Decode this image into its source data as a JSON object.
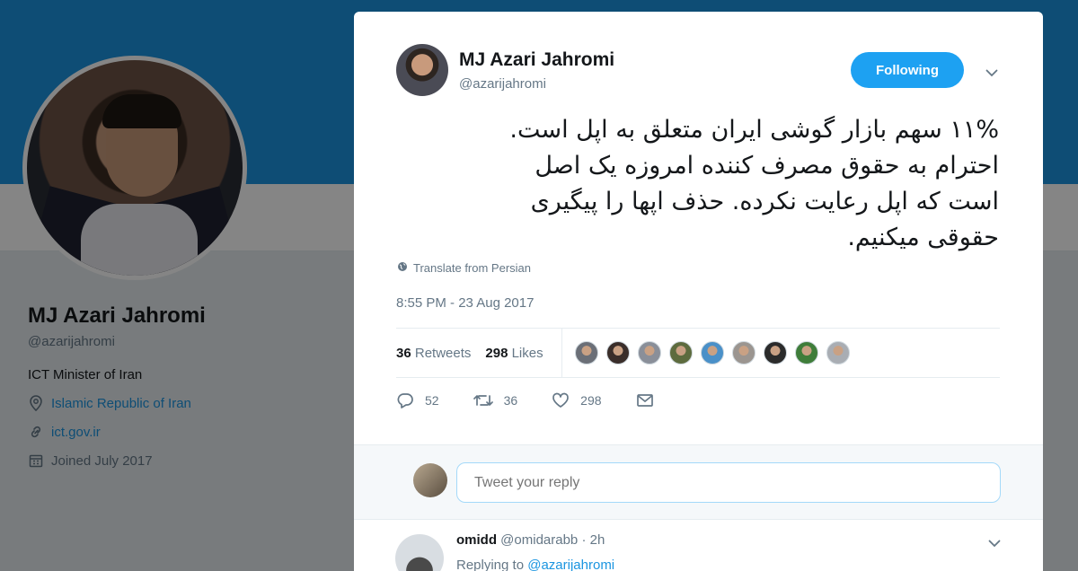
{
  "profile": {
    "name": "MJ Azari Jahromi",
    "handle": "@azarijahromi",
    "bio": "ICT Minister of Iran",
    "location": "Islamic Republic of Iran",
    "website": "ict.gov.ir",
    "joined": "Joined July 2017",
    "location_icon": "location-pin-icon",
    "link_icon": "link-icon",
    "calendar_icon": "calendar-icon"
  },
  "tweet": {
    "author_name": "MJ Azari Jahromi",
    "author_handle": "@azarijahromi",
    "follow_label": "Following",
    "text_lines": [
      "۱۱% سهم بازار گوشی ایران متعلق به اپل است.",
      "احترام به حقوق مصرف کننده امروزه یک اصل",
      "است که اپل رعایت نکرده. حذف اپها را پیگیری",
      "حقوقی میکنیم."
    ],
    "translate_label": "Translate from Persian",
    "timestamp": "8:55 PM - 23 Aug 2017",
    "retweets_count": "36",
    "retweets_label": "Retweets",
    "likes_count": "298",
    "likes_label": "Likes",
    "reply_count": "52",
    "retweet_action_count": "36",
    "like_action_count": "298",
    "accent_color": "#1da1f2"
  },
  "liker_colors": [
    "#6b6f77",
    "#3a2e2a",
    "#8a8f99",
    "#5d6b3e",
    "#4a90c8",
    "#9b9590",
    "#2b2b2b",
    "#3f7d3a",
    "#a9adb3"
  ],
  "reply_box": {
    "placeholder": "Tweet your reply"
  },
  "reply_tweet": {
    "name": "omidd",
    "handle": "@omidarabb",
    "time": "· 2h",
    "replying_prefix": "Replying to",
    "replying_to": "@azarijahromi"
  }
}
